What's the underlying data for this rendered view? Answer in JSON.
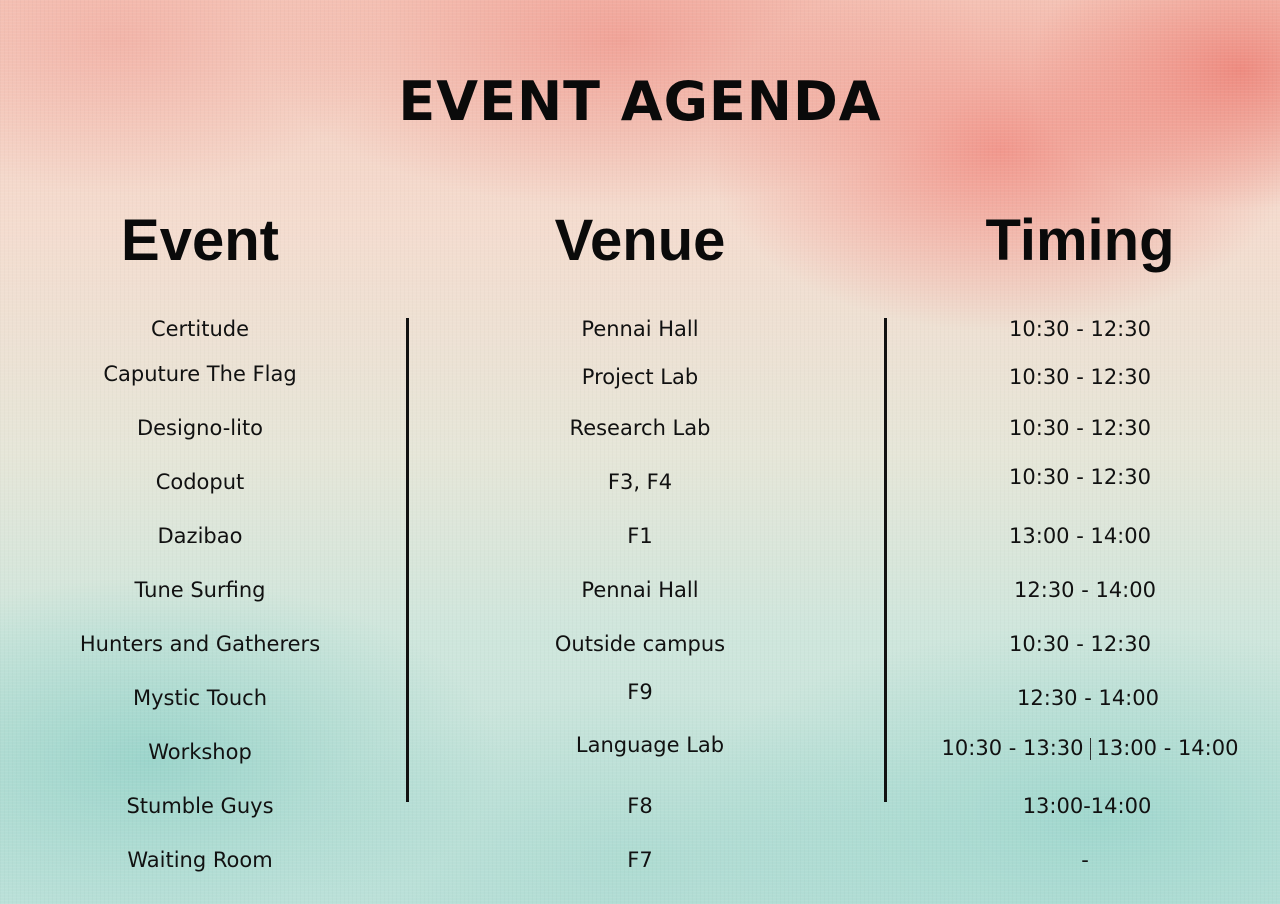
{
  "title": "EVENT AGENDA",
  "columns": {
    "event": "Event",
    "venue": "Venue",
    "timing": "Timing"
  },
  "rows": [
    {
      "event": "Certitude",
      "venue": "Pennai Hall",
      "timing": "10:30 - 12:30"
    },
    {
      "event": "Caputure The Flag",
      "venue": "Project Lab",
      "timing": "10:30 - 12:30"
    },
    {
      "event": "Designo-lito",
      "venue": "Research Lab",
      "timing": "10:30 - 12:30"
    },
    {
      "event": "Codoput",
      "venue": "F3, F4",
      "timing": "10:30 - 12:30"
    },
    {
      "event": "Dazibao",
      "venue": "F1",
      "timing": "13:00 - 14:00"
    },
    {
      "event": "Tune Surfing",
      "venue": "Pennai Hall",
      "timing": "12:30 - 14:00"
    },
    {
      "event": "Hunters and Gatherers",
      "venue": "Outside campus",
      "timing": "10:30 - 12:30"
    },
    {
      "event": "Mystic Touch",
      "venue": "F9",
      "timing": "12:30 - 14:00"
    },
    {
      "event": "Workshop",
      "venue": "Language Lab",
      "timing": "10:30 - 13:30",
      "timing_b": "13:00 - 14:00"
    },
    {
      "event": "Stumble  Guys",
      "venue": "F8",
      "timing": "13:00-14:00"
    },
    {
      "event": "Waiting Room",
      "venue": "F7",
      "timing": "-"
    }
  ]
}
